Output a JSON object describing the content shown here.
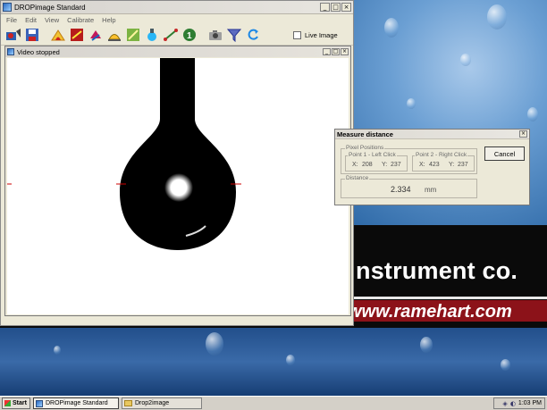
{
  "app": {
    "title": "DROPimage Standard",
    "menu": [
      "File",
      "Edit",
      "View",
      "Calibrate",
      "Help"
    ],
    "toolbar": {
      "buttons": [
        {
          "icon": "camera-icon"
        },
        {
          "icon": "save-icon"
        },
        {
          "icon": "contact-angle-icon"
        },
        {
          "icon": "measure-red-icon"
        },
        {
          "icon": "tilt-icon"
        },
        {
          "icon": "sessile-drop-icon"
        },
        {
          "icon": "ruler-icon"
        },
        {
          "icon": "pendant-drop-icon"
        },
        {
          "icon": "line-measure-icon"
        },
        {
          "icon": "one-icon"
        },
        {
          "icon": "camera-settings-icon"
        },
        {
          "icon": "funnel-icon"
        },
        {
          "icon": "refresh-icon"
        }
      ],
      "live_image_label": "Live Image",
      "live_image_checked": false
    }
  },
  "video_window": {
    "title": "Video stopped"
  },
  "measure_dialog": {
    "title": "Measure distance",
    "pixel_positions_label": "Pixel Positions",
    "point1": {
      "label": "Point 1 - Left Click",
      "x_label": "X:",
      "x": "208",
      "y_label": "Y:",
      "y": "237"
    },
    "point2": {
      "label": "Point 2 - Right Click",
      "x_label": "X:",
      "x": "423",
      "y_label": "Y:",
      "y": "237"
    },
    "distance_label": "Distance",
    "distance_value": "2.334",
    "distance_unit": "mm",
    "cancel_label": "Cancel"
  },
  "wallpaper": {
    "banner_text": "nstrument co.",
    "banner_url": "www.ramehart.com"
  },
  "taskbar": {
    "start_label": "Start",
    "tasks": [
      {
        "label": "DROPimage Standard",
        "active": true
      },
      {
        "label": "Drop2image",
        "active": false
      }
    ],
    "clock": "1:03 PM"
  }
}
